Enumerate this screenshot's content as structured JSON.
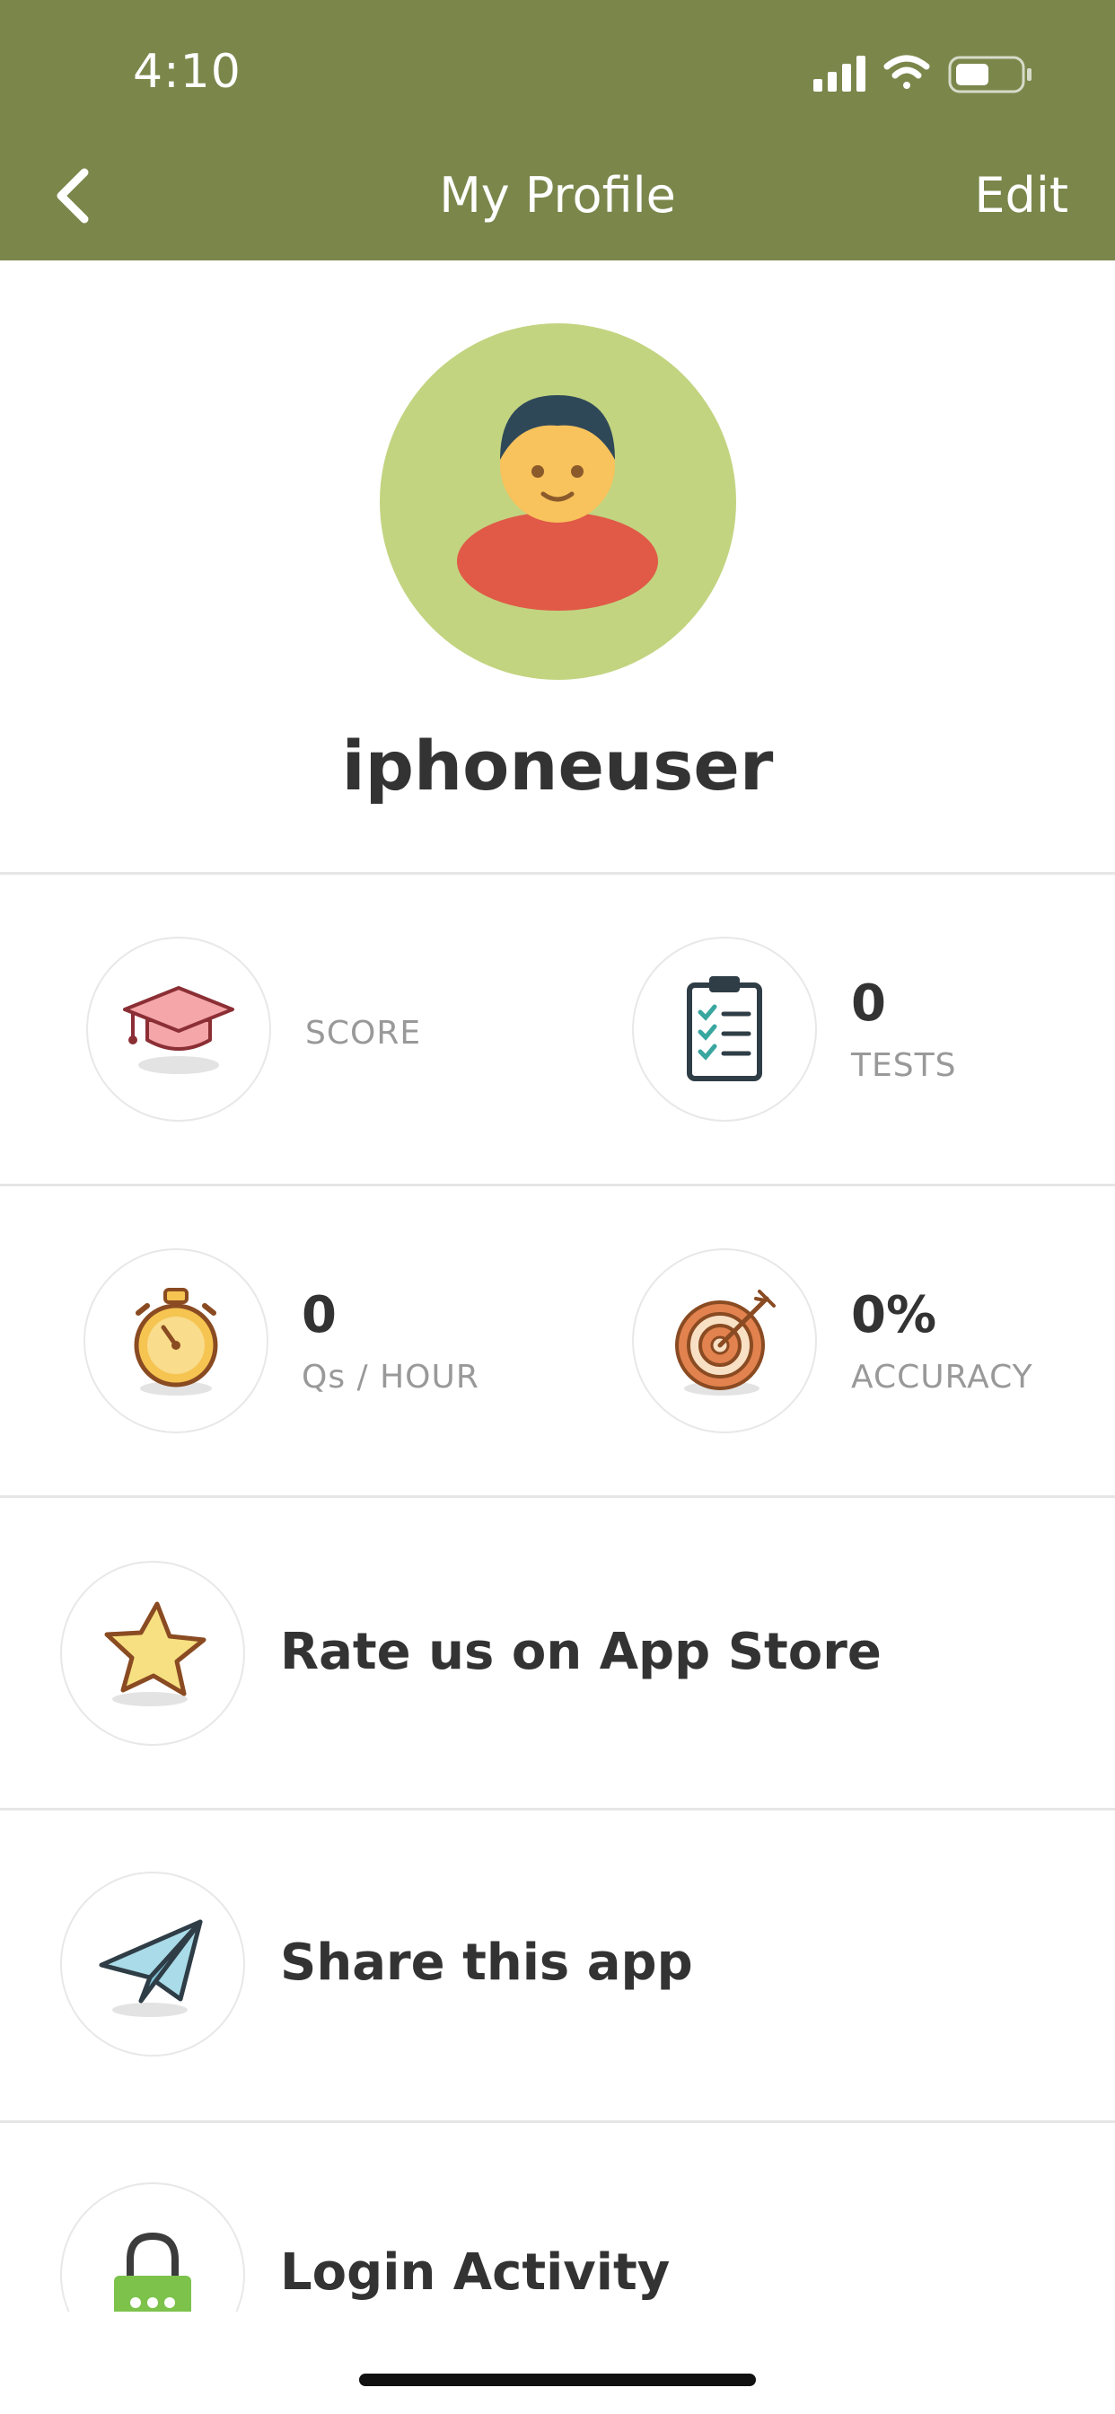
{
  "status_bar": {
    "time": "4:10"
  },
  "header": {
    "title": "My Profile",
    "edit_label": "Edit",
    "back_icon": "chevron-left-icon",
    "color": "#7b864b"
  },
  "profile": {
    "username": "iphoneuser",
    "avatar_bg": "#c2d480"
  },
  "stats": {
    "score": {
      "value": "",
      "label": "SCORE",
      "icon": "graduation-cap-icon"
    },
    "tests": {
      "value": "0",
      "label": "TESTS",
      "icon": "clipboard-icon"
    },
    "qs_per_hour": {
      "value": "0",
      "label": "Qs / HOUR",
      "icon": "stopwatch-icon"
    },
    "accuracy": {
      "value": "0%",
      "label": "ACCURACY",
      "icon": "target-icon"
    }
  },
  "actions": {
    "rate": {
      "label": "Rate us on App Store",
      "icon": "star-icon"
    },
    "share": {
      "label": "Share this app",
      "icon": "paper-plane-icon"
    },
    "login_activity": {
      "label": "Login Activity",
      "icon": "lock-icon"
    }
  }
}
